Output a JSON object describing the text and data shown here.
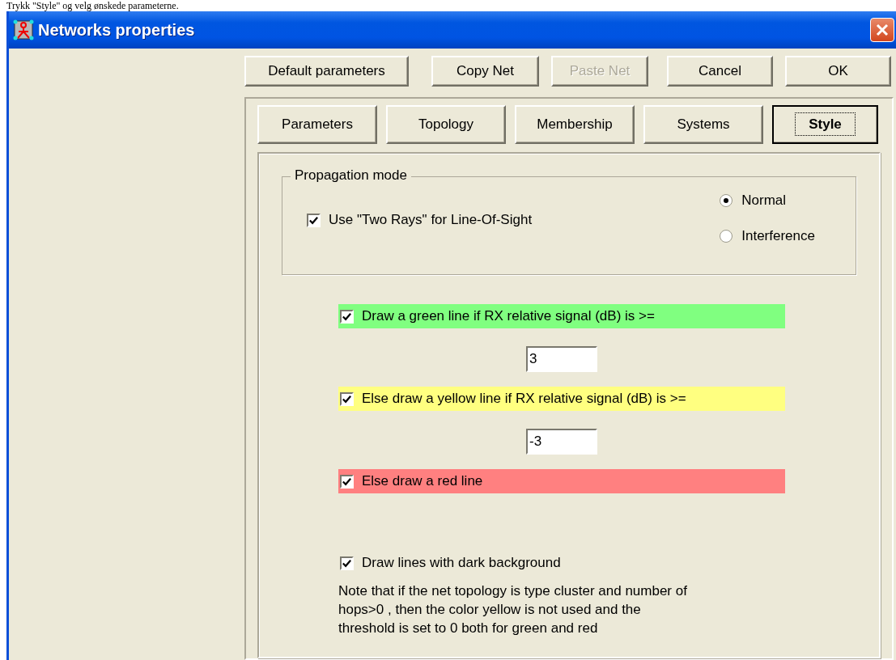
{
  "caption": "Trykk \"Style\" og velg ønskede parameterne.",
  "window": {
    "title": "Networks properties"
  },
  "buttons": [
    {
      "label": "Default parameters",
      "disabled": false
    },
    {
      "label": "Copy Net",
      "disabled": false
    },
    {
      "label": "Paste Net",
      "disabled": true
    },
    {
      "label": "Cancel",
      "disabled": false
    },
    {
      "label": "OK",
      "disabled": false
    }
  ],
  "tabs": [
    {
      "label": "Parameters",
      "selected": false
    },
    {
      "label": "Topology",
      "selected": false
    },
    {
      "label": "Membership",
      "selected": false
    },
    {
      "label": "Systems",
      "selected": false
    },
    {
      "label": "Style",
      "selected": true
    }
  ],
  "propagation": {
    "title": "Propagation mode",
    "two_rays": {
      "label": "Use \"Two Rays\" for Line-Of-Sight",
      "checked": true
    },
    "modes": [
      {
        "label": "Normal",
        "selected": true
      },
      {
        "label": "Interference",
        "selected": false
      }
    ]
  },
  "thresholds": [
    {
      "label": "Draw a green line if RX relative signal (dB) is >=",
      "checked": true,
      "color": "#80ff80",
      "value": "3"
    },
    {
      "label": "Else draw a yellow line if RX relative signal (dB) is >=",
      "checked": true,
      "color": "#ffff80",
      "value": "-3"
    },
    {
      "label": "Else draw a red line",
      "checked": true,
      "color": "#ff8080"
    }
  ],
  "dark_background": {
    "label": "Draw lines with dark background",
    "checked": true
  },
  "note": "Note that if the net topology is type cluster and number of\nhops>0 , then the color yellow is not used and the\nthreshold is set to 0 both for green and red"
}
